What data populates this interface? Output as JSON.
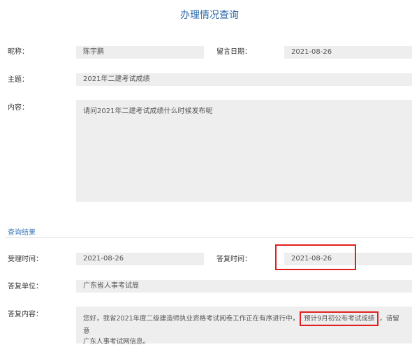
{
  "page": {
    "title": "办理情况查询"
  },
  "message": {
    "nickname_label": "昵称：",
    "nickname_value": "陈宇鹏",
    "date_label": "留言日期：",
    "date_value": "2021-08-26",
    "subject_label": "主题：",
    "subject_value": "2021年二建考试成绩",
    "content_label": "内容：",
    "content_value": "请问2021年二建考试成绩什么时候发布呢"
  },
  "result": {
    "section_title": "查询结果",
    "accept_time_label": "受理时间：",
    "accept_time_value": "2021-08-26",
    "reply_time_label": "答复时间：",
    "reply_time_value": "2021-08-26",
    "reply_unit_label": "答复单位：",
    "reply_unit_value": "广东省人事考试局",
    "reply_content_label": "答复内容：",
    "reply_content_part1": "您好，我省2021年度二级建造师执业资格考试阅卷工作正在有序进行中，",
    "reply_content_highlight": "预计9月初公布考试成绩",
    "reply_content_part2": "，请留意",
    "reply_content_line2": "广东人事考试网信息。"
  },
  "colors": {
    "title": "#2f6aa8",
    "highlight_border": "#e02020",
    "field_bg": "#eeeeee"
  }
}
